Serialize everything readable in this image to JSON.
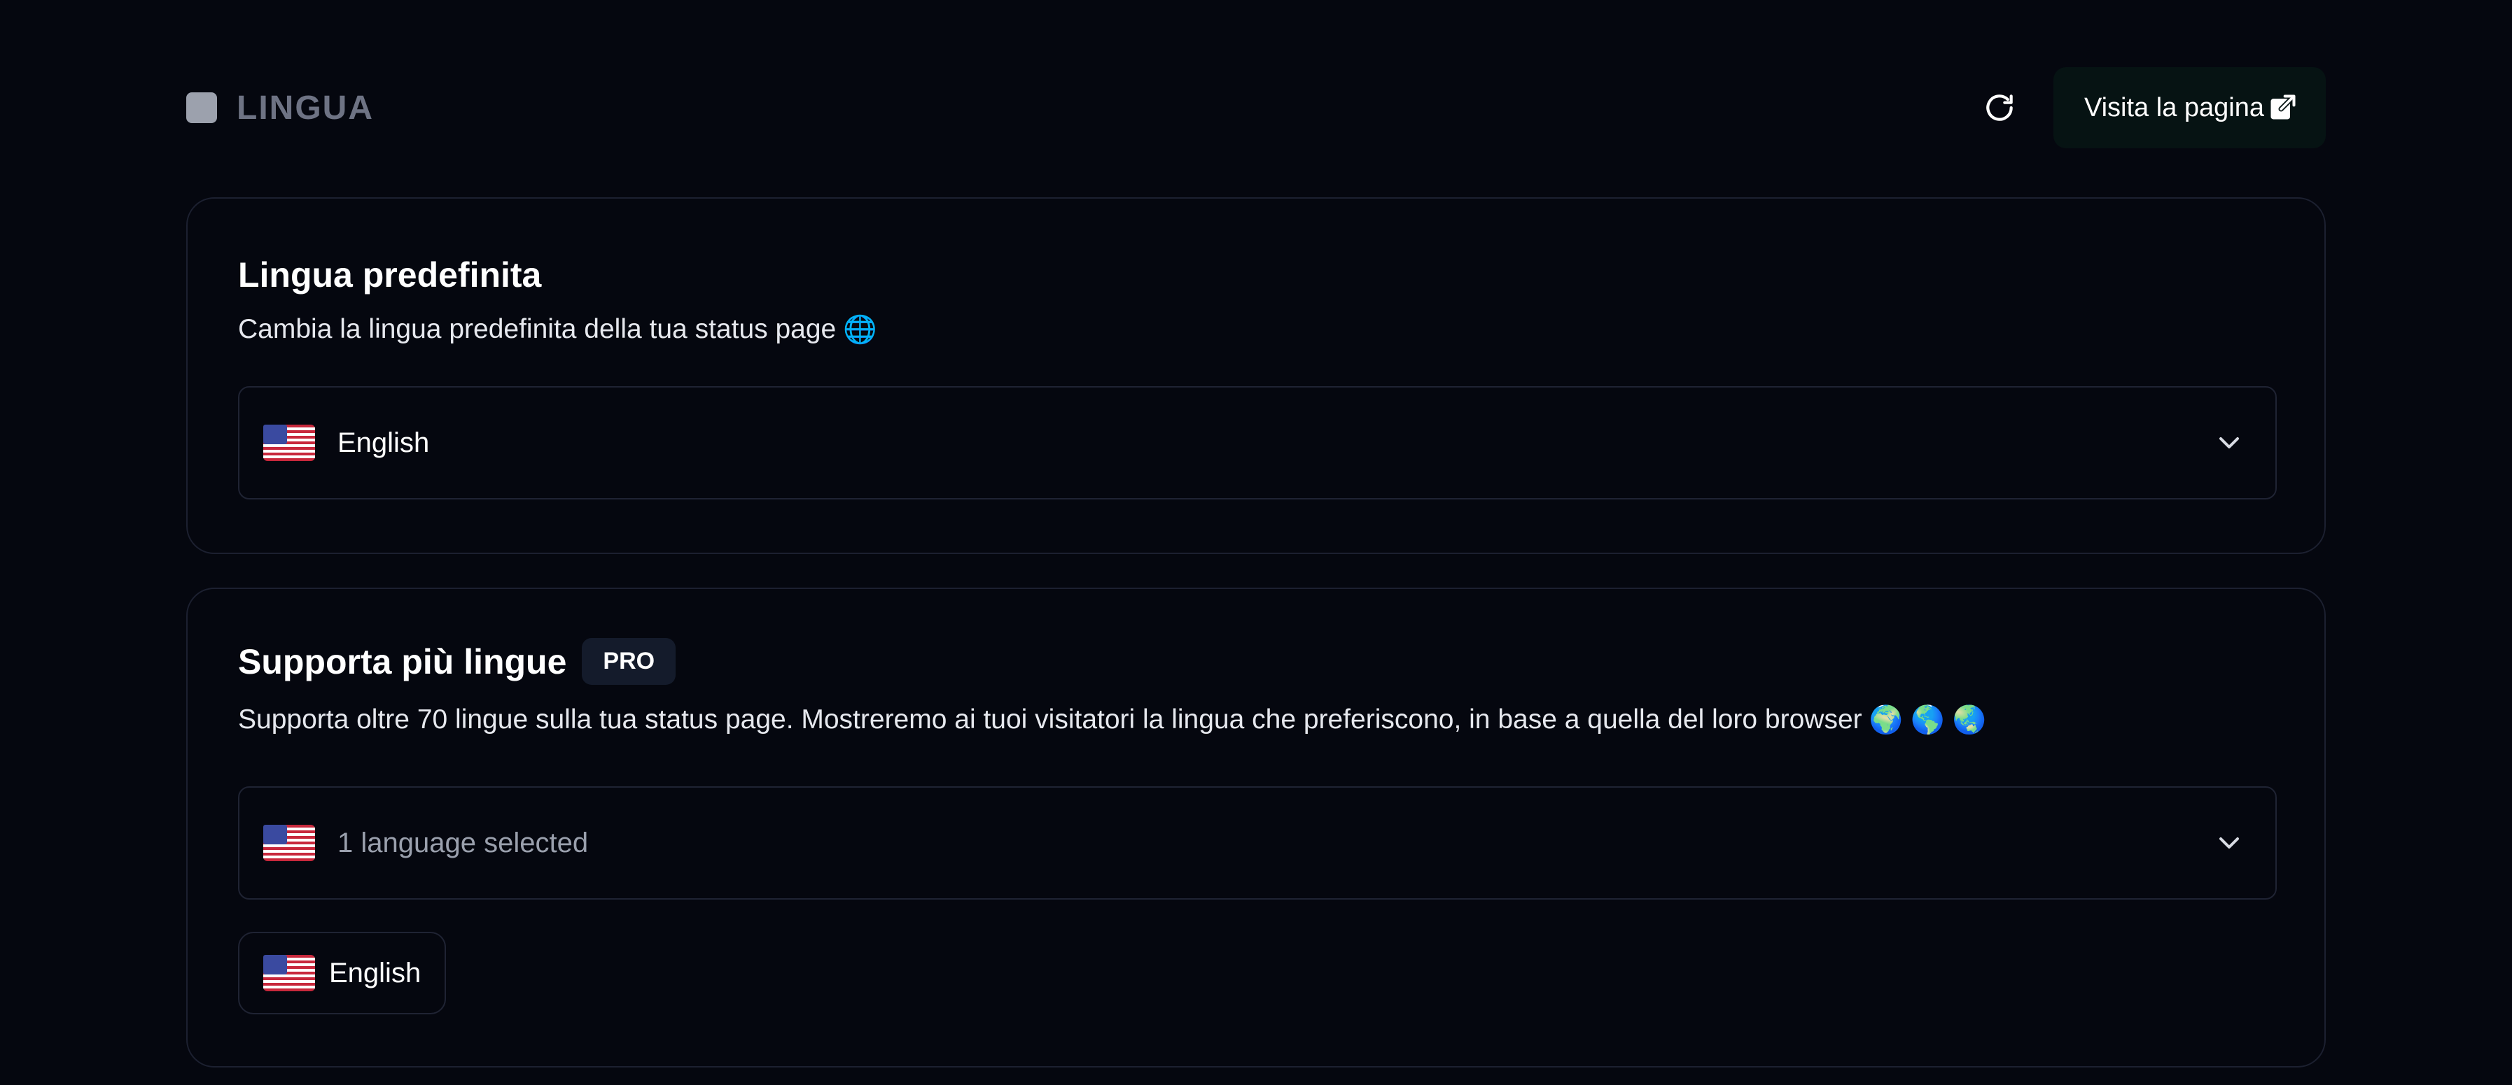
{
  "header": {
    "section_title": "LINGUA",
    "visit_label": "Visita la pagina",
    "icons": {
      "section": "square-icon",
      "refresh": "refresh-icon",
      "external": "external-link-icon"
    }
  },
  "default_language": {
    "title": "Lingua predefinita",
    "description": "Cambia la lingua predefinita della tua status page",
    "description_emoji": "🌐",
    "select": {
      "flag": "us-flag-icon",
      "value": "English"
    }
  },
  "multi_language": {
    "title": "Supporta più lingue",
    "badge": "PRO",
    "description": "Supporta oltre 70 lingue sulla tua status page. Mostreremo ai tuoi visitatori la lingua che preferiscono, in base a quella del loro browser",
    "description_emoji": "🌍 🌎 🌏",
    "select": {
      "flag": "us-flag-icon",
      "placeholder": "1 language selected"
    },
    "selected": [
      {
        "flag": "us-flag-icon",
        "label": "English"
      }
    ]
  },
  "colors": {
    "background": "#05070f",
    "card_border": "#1c2030",
    "muted_text": "#6e7384",
    "visit_button_bg": "#061313",
    "badge_bg": "#141b2b"
  }
}
